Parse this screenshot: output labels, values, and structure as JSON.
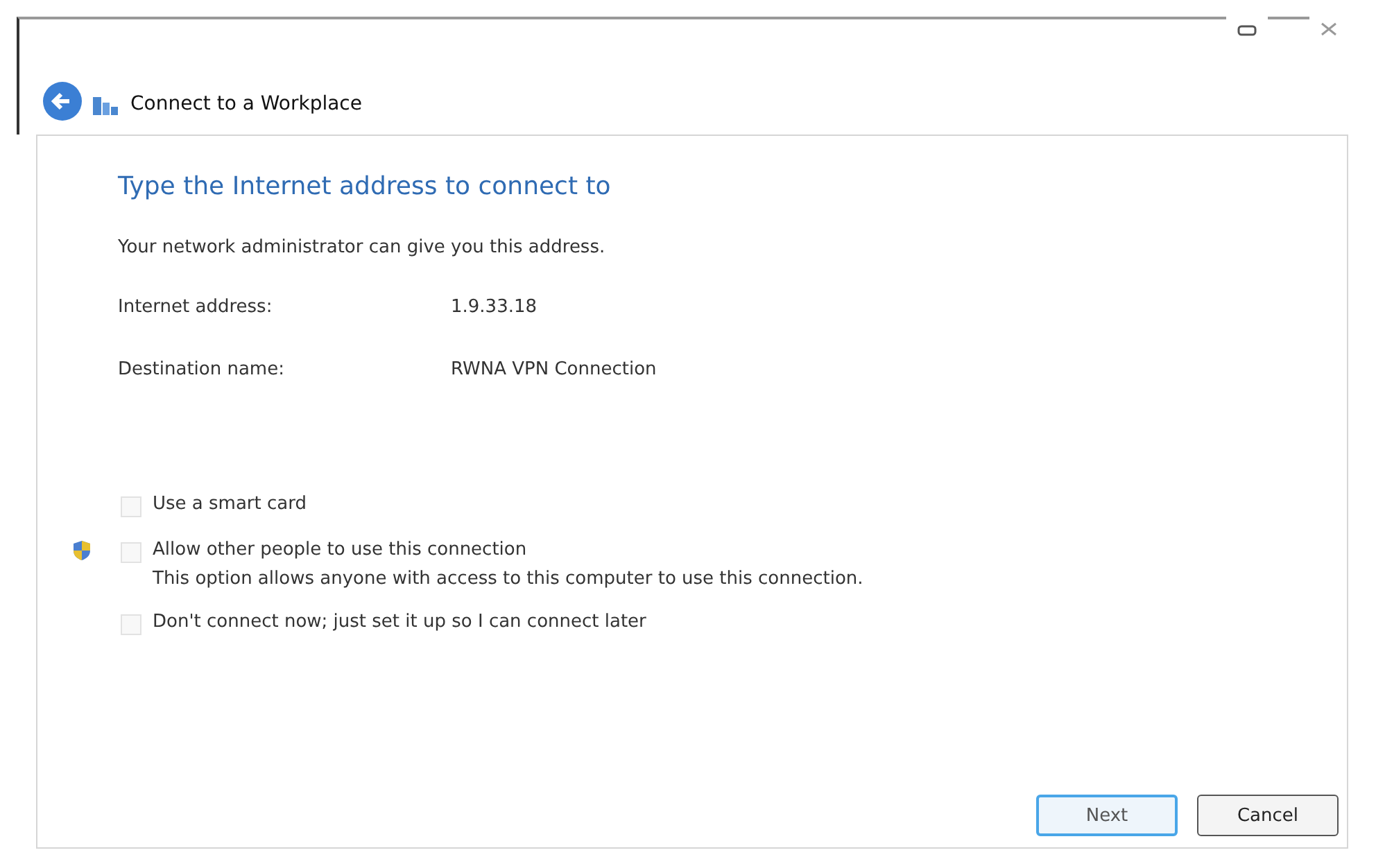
{
  "window": {
    "title": "Connect to a Workplace"
  },
  "heading": "Type the Internet address to connect to",
  "description": "Your network administrator can give you this address.",
  "fields": [
    {
      "label": "Internet address:",
      "value": "1.9.33.18"
    },
    {
      "label": "Destination name:",
      "value": "RWNA VPN Connection"
    }
  ],
  "options": [
    {
      "kind": "plain",
      "label": "Use a smart card",
      "checked": false
    },
    {
      "kind": "admin",
      "label": "Allow other people to use this connection",
      "note": "This option allows anyone with access to this computer to use this connection.",
      "checked": false
    },
    {
      "kind": "plain",
      "label": "Don't connect now; just set it up so I can connect later",
      "checked": false
    }
  ],
  "buttons": [
    {
      "label": "Next",
      "kind": "default"
    },
    {
      "label": "Cancel",
      "kind": "normal"
    }
  ]
}
